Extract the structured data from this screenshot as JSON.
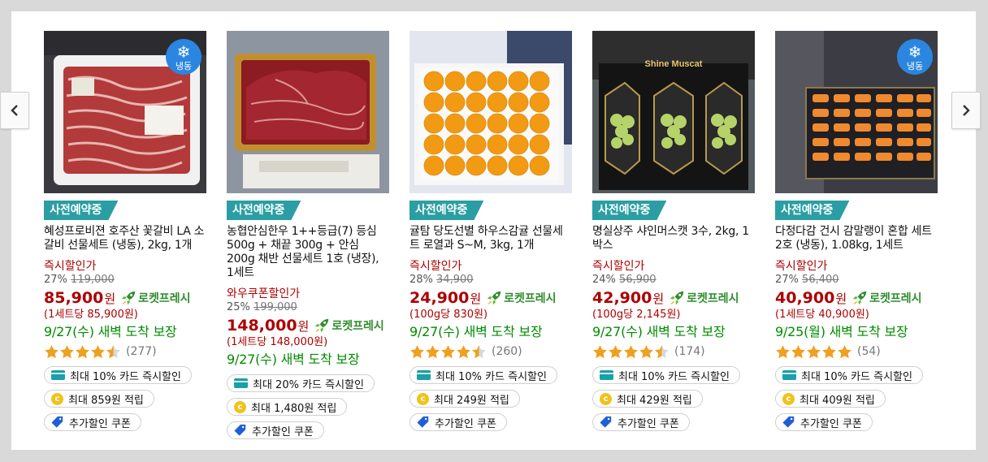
{
  "colors": {
    "price_red": "#ae0000",
    "delivery_green": "#008c00",
    "preorder_teal": "#2a9ea3",
    "rocket_green": "#2f8d2f",
    "frozen_blue": "#2a86e0"
  },
  "carousel": {
    "prev_icon": "chevron-left-icon",
    "next_icon": "chevron-right-icon"
  },
  "products": [
    {
      "frozen_label": "냉동",
      "badge": "사전예약중",
      "name": "혜성프로비젼 호주산 꽃갈비 LA 소갈비 선물세트 (냉동), 2kg, 1개",
      "promo_label": "즉시할인가",
      "discount": "27%",
      "original_price": "119,000",
      "price": "85,900",
      "currency": "원",
      "rocket_label": "로켓프레시",
      "unit_price": "(1세트당 85,900원)",
      "delivery": "9/27(수) 새벽 도착 보장",
      "rating": 4.5,
      "review_count": "(277)",
      "card_discount": "최대 10% 카드 즉시할인",
      "cashback": "최대 859원 적립",
      "coupon": "추가할인 쿠폰"
    },
    {
      "badge": "사전예약중",
      "name": "농협안심한우 1++등급(7) 등심 500g + 채끝 300g + 안심 200g 채반 선물세트 1호 (냉장), 1세트",
      "promo_label": "와우쿠폰할인가",
      "discount": "25%",
      "original_price": "199,000",
      "price": "148,000",
      "currency": "원",
      "rocket_label": "로켓프레시",
      "unit_price": "(1세트당 148,000원)",
      "delivery": "9/27(수) 새벽 도착 보장",
      "card_discount": "최대 20% 카드 즉시할인",
      "cashback": "최대 1,480원 적립",
      "coupon": "추가할인 쿠폰"
    },
    {
      "badge": "사전예약중",
      "name": "귤탐 당도선별 하우스감귤 선물세트 로열과 S~M, 3kg, 1개",
      "promo_label": "즉시할인가",
      "discount": "28%",
      "original_price": "34,900",
      "price": "24,900",
      "currency": "원",
      "rocket_label": "로켓프레시",
      "unit_price": "(100g당 830원)",
      "delivery": "9/27(수) 새벽 도착 보장",
      "rating": 4.5,
      "review_count": "(260)",
      "card_discount": "최대 10% 카드 즉시할인",
      "cashback": "최대 249원 적립",
      "coupon": "추가할인 쿠폰"
    },
    {
      "image_text": "Shine Muscat",
      "badge": "사전예약중",
      "name": "명실상주 샤인머스캣 3수, 2kg, 1박스",
      "promo_label": "즉시할인가",
      "discount": "24%",
      "original_price": "56,900",
      "price": "42,900",
      "currency": "원",
      "rocket_label": "로켓프레시",
      "unit_price": "(100g당 2,145원)",
      "delivery": "9/27(수) 새벽 도착 보장",
      "rating": 4.5,
      "review_count": "(174)",
      "card_discount": "최대 10% 카드 즉시할인",
      "cashback": "최대 429원 적립",
      "coupon": "추가할인 쿠폰"
    },
    {
      "frozen_label": "냉동",
      "badge": "사전예약중",
      "name": "다정다감 건시 감말랭이 혼합 세트 2호 (냉동), 1.08kg, 1세트",
      "promo_label": "즉시할인가",
      "discount": "27%",
      "original_price": "56,400",
      "price": "40,900",
      "currency": "원",
      "rocket_label": "로켓프레시",
      "unit_price": "(1세트당 40,900원)",
      "delivery": "9/25(월) 새벽 도착 보장",
      "rating": 5,
      "review_count": "(54)",
      "card_discount": "최대 10% 카드 즉시할인",
      "cashback": "최대 409원 적립",
      "coupon": "추가할인 쿠폰"
    }
  ]
}
